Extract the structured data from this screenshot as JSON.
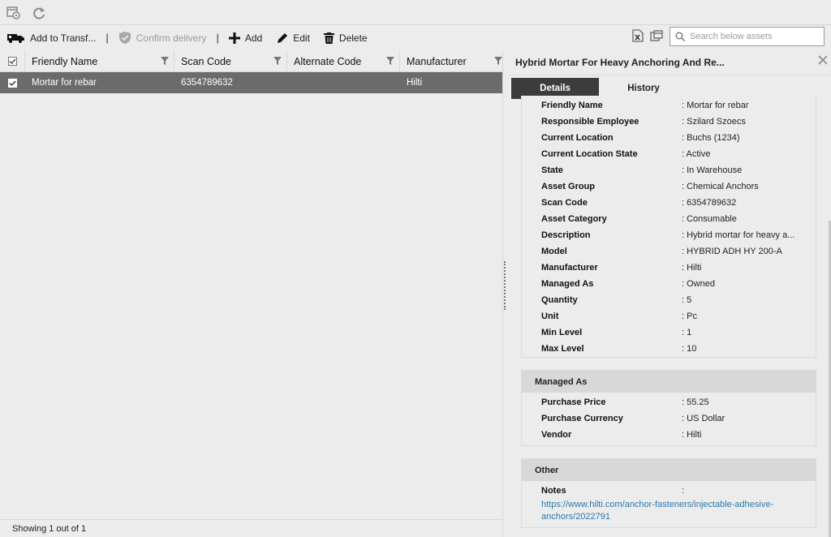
{
  "toolbar": {
    "add_to_transfer": "Add to Transf...",
    "confirm_delivery": "Confirm delivery",
    "separator": "|",
    "add": "Add",
    "edit": "Edit",
    "delete": "Delete",
    "search_placeholder": "Search below assets"
  },
  "grid": {
    "columns": [
      "Friendly Name",
      "Scan Code",
      "Alternate Code",
      "Manufacturer"
    ],
    "rows": [
      {
        "friendly_name": "Mortar for rebar",
        "scan_code": "6354789632",
        "alternate_code": "",
        "manufacturer": "Hilti",
        "selected": true
      }
    ],
    "footer": "Showing 1 out of 1"
  },
  "detail": {
    "title": "Hybrid Mortar For Heavy Anchoring And Re...",
    "tabs": [
      "Details",
      "History"
    ],
    "general": [
      {
        "label": "Friendly Name",
        "value": ": Mortar for rebar"
      },
      {
        "label": "Responsible Employee",
        "value": ": Szilard Szoecs"
      },
      {
        "label": "Current Location",
        "value": ": Buchs (1234)"
      },
      {
        "label": "Current Location State",
        "value": ": Active"
      },
      {
        "label": "State",
        "value": ": In Warehouse"
      },
      {
        "label": "Asset Group",
        "value": ": Chemical Anchors"
      },
      {
        "label": "Scan Code",
        "value": ": 6354789632"
      },
      {
        "label": "Asset Category",
        "value": ": Consumable"
      },
      {
        "label": "Description",
        "value": ": Hybrid mortar for heavy a..."
      },
      {
        "label": "Model",
        "value": ": HYBRID ADH HY 200-A"
      },
      {
        "label": "Manufacturer",
        "value": ": Hilti"
      },
      {
        "label": "Managed As",
        "value": ": Owned"
      },
      {
        "label": "Quantity",
        "value": ": 5"
      },
      {
        "label": "Unit",
        "value": ": Pc"
      },
      {
        "label": "Min Level",
        "value": ": 1"
      },
      {
        "label": "Max Level",
        "value": ": 10"
      }
    ],
    "managed_title": "Managed As",
    "managed": [
      {
        "label": "Purchase Price",
        "value": ": 55.25"
      },
      {
        "label": "Purchase Currency",
        "value": ": US Dollar"
      },
      {
        "label": "Vendor",
        "value": ": Hilti"
      }
    ],
    "other_title": "Other",
    "notes_label": "Notes",
    "notes_colon": ":",
    "notes_link_line1": "https://www.hilti.com/anchor-fasteners/injectable-adhesive-",
    "notes_link_line2": "anchors/2022791"
  },
  "colors": {
    "selected_row": "#6b6b6b",
    "active_tab": "#3c3c3c",
    "link": "#2a7ab0"
  }
}
